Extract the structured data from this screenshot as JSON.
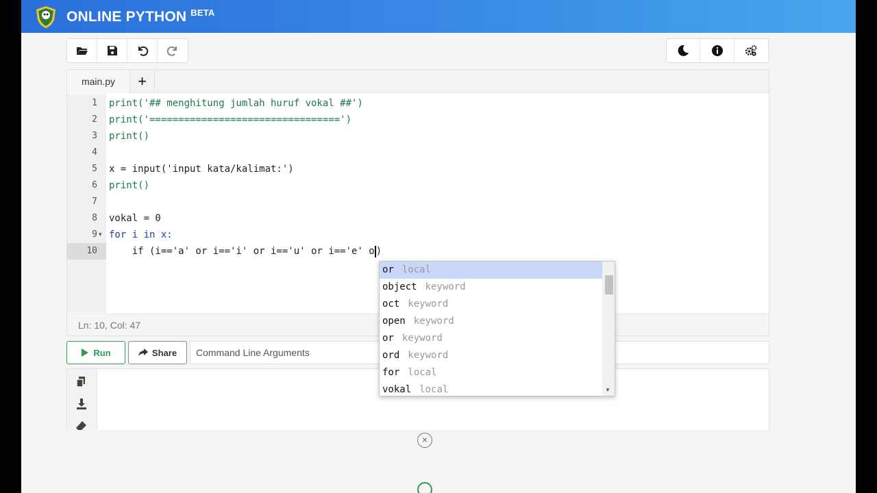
{
  "app": {
    "brand": "ONLINE PYTHON",
    "badge": "BETA"
  },
  "toolbar": {
    "left": [
      "open-folder-icon",
      "save-icon",
      "undo-icon",
      "redo-icon"
    ],
    "right": [
      "dark-mode-icon",
      "info-icon",
      "settings-icon"
    ]
  },
  "tabs": {
    "file": "main.py",
    "add": "+"
  },
  "editor": {
    "line_numbers": [
      "1",
      "2",
      "3",
      "4",
      "5",
      "6",
      "7",
      "8",
      "9",
      "10"
    ],
    "lines": [
      "print('## menghitung jumlah huruf vokal ##')",
      "print('=================================')",
      "print()",
      "",
      "x = input('input kata/kalimat:')",
      "print()",
      "",
      "vokal = 0",
      "for i in x:",
      "    if (i=='a' or i=='i' or i=='u' or i=='e' o"
    ],
    "trailing_char": ")",
    "status": "Ln: 10,  Col: 47"
  },
  "actions": {
    "run_label": "Run",
    "share_label": "Share",
    "args_placeholder": "Command Line Arguments"
  },
  "autocomplete": {
    "items": [
      {
        "word": "or",
        "meta": "local"
      },
      {
        "word": "object",
        "meta": "keyword"
      },
      {
        "word": "oct",
        "meta": "keyword"
      },
      {
        "word": "open",
        "meta": "keyword"
      },
      {
        "word": "or",
        "meta": "keyword"
      },
      {
        "word": "ord",
        "meta": "keyword"
      },
      {
        "word": "for",
        "meta": "local"
      },
      {
        "word": "vokal",
        "meta": "local"
      }
    ]
  },
  "output_tools": [
    "copy-icon",
    "download-icon",
    "eraser-icon"
  ],
  "overlay": {
    "close": "×"
  },
  "colors": {
    "header_start": "#2a6fdb",
    "header_end": "#48a6ec",
    "run_green": "#2f9a53",
    "selection": "#cad6fa"
  }
}
